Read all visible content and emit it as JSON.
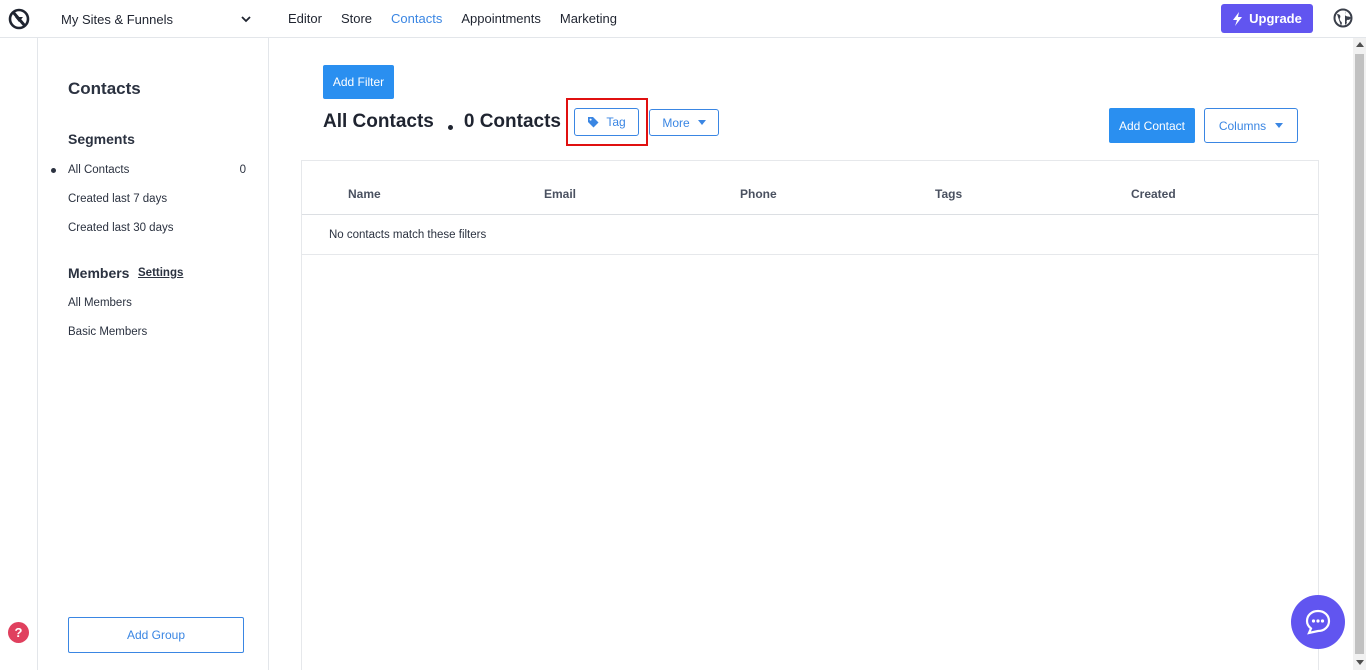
{
  "colors": {
    "accent": "#3a86e3",
    "primary_button": "#2a8ff0",
    "upgrade": "#6155f0",
    "highlight": "#e01010",
    "help": "#e0405e"
  },
  "header": {
    "site_switcher": "My Sites & Funnels",
    "nav": [
      {
        "label": "Editor",
        "active": false
      },
      {
        "label": "Store",
        "active": false
      },
      {
        "label": "Contacts",
        "active": true
      },
      {
        "label": "Appointments",
        "active": false
      },
      {
        "label": "Marketing",
        "active": false
      }
    ],
    "upgrade_label": "Upgrade",
    "icons": {
      "logo": "brand-logo-icon",
      "globe": "globe-icon",
      "chevron": "chevron-down-icon",
      "bolt": "lightning-icon"
    }
  },
  "sidebar": {
    "title": "Contacts",
    "segments_heading": "Segments",
    "segments": [
      {
        "label": "All Contacts",
        "count": "0",
        "selected": true
      },
      {
        "label": "Created last 7 days",
        "count": ""
      },
      {
        "label": "Created last 30 days",
        "count": ""
      }
    ],
    "members_heading": "Members",
    "settings_link": "Settings",
    "members": [
      {
        "label": "All Members"
      },
      {
        "label": "Basic Members"
      }
    ],
    "add_group_label": "Add Group"
  },
  "main": {
    "add_filter_label": "Add Filter",
    "title": "All Contacts",
    "count_label": "0 Contacts",
    "tag_label": "Tag",
    "more_label": "More",
    "add_contact_label": "Add Contact",
    "columns_label": "Columns",
    "table": {
      "columns": [
        "Name",
        "Email",
        "Phone",
        "Tags",
        "Created"
      ],
      "empty_message": "No contacts match these filters"
    }
  },
  "help_label": "?",
  "chat_icon": "chat-icon"
}
